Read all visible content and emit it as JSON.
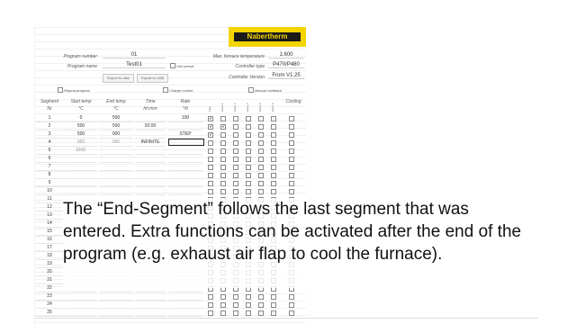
{
  "program": {
    "number_label": "Program number",
    "number_value": "01",
    "name_label": "Program name",
    "name_value": "Test01",
    "use_preset_label": "Use preset",
    "export_disk_label": "Export to disk",
    "export_usb_label": "Export to USB",
    "repeat_label": "Repeat program",
    "charge_label": "Charge control",
    "manual_holdback_label": "Manual holdback"
  },
  "furnace": {
    "max_temp_label": "Max. furnace temperature",
    "max_temp_value": "1.600",
    "controller_type_label": "Controller type",
    "controller_type_value": "P470/P480",
    "controller_version_label": "Controller Version",
    "controller_version_value": "From V1.25"
  },
  "logo_text": "Nabertherm",
  "table": {
    "headers": {
      "segment": "Segment",
      "segment_unit": "Nr",
      "start_temp": "Start temp",
      "start_unit": "°C",
      "end_temp": "End temp",
      "end_unit": "°C",
      "time": "Time",
      "time_unit": "hh:mm",
      "rate": "Rate",
      "rate_unit": "°/h",
      "cooling": "Cooling"
    },
    "extra_headers": [
      "Flap",
      "Extra 2",
      "Extra 3",
      "Extra 4",
      "Extra 5",
      "Extra 6"
    ],
    "rows": [
      {
        "nr": "1",
        "start": "0",
        "end": "500",
        "time": "",
        "rate": "100"
      },
      {
        "nr": "2",
        "start": "500",
        "end": "500",
        "time": "02:00",
        "rate": ""
      },
      {
        "nr": "3",
        "start": "500",
        "end": "900",
        "time": "",
        "rate": "STEP"
      },
      {
        "nr": "4",
        "start": "900",
        "end": "900",
        "time": "INFINITE",
        "rate": ""
      },
      {
        "nr": "5",
        "start": "END",
        "end": "",
        "time": "",
        "rate": ""
      },
      {
        "nr": "6",
        "start": "",
        "end": "",
        "time": "",
        "rate": ""
      },
      {
        "nr": "7",
        "start": "",
        "end": "",
        "time": "",
        "rate": ""
      },
      {
        "nr": "8",
        "start": "",
        "end": "",
        "time": "",
        "rate": ""
      },
      {
        "nr": "9",
        "start": "",
        "end": "",
        "time": "",
        "rate": ""
      },
      {
        "nr": "10",
        "start": "",
        "end": "",
        "time": "",
        "rate": ""
      },
      {
        "nr": "11",
        "start": "",
        "end": "",
        "time": "",
        "rate": ""
      },
      {
        "nr": "12",
        "start": "",
        "end": "",
        "time": "",
        "rate": ""
      },
      {
        "nr": "13",
        "start": "",
        "end": "",
        "time": "",
        "rate": ""
      },
      {
        "nr": "14",
        "start": "",
        "end": "",
        "time": "",
        "rate": ""
      },
      {
        "nr": "15",
        "start": "",
        "end": "",
        "time": "",
        "rate": ""
      },
      {
        "nr": "16",
        "start": "",
        "end": "",
        "time": "",
        "rate": ""
      },
      {
        "nr": "17",
        "start": "",
        "end": "",
        "time": "",
        "rate": ""
      },
      {
        "nr": "18",
        "start": "",
        "end": "",
        "time": "",
        "rate": ""
      },
      {
        "nr": "19",
        "start": "",
        "end": "",
        "time": "",
        "rate": ""
      },
      {
        "nr": "20",
        "start": "",
        "end": "",
        "time": "",
        "rate": ""
      },
      {
        "nr": "21",
        "start": "",
        "end": "",
        "time": "",
        "rate": ""
      },
      {
        "nr": "22",
        "start": "",
        "end": "",
        "time": "",
        "rate": ""
      },
      {
        "nr": "23",
        "start": "",
        "end": "",
        "time": "",
        "rate": ""
      },
      {
        "nr": "24",
        "start": "",
        "end": "",
        "time": "",
        "rate": ""
      },
      {
        "nr": "25",
        "start": "",
        "end": "",
        "time": "",
        "rate": ""
      }
    ]
  },
  "caption": "The “End-Segment” follows the last segment that was entered. Extra functions can be activated after the end of the program (e.g. exhaust air flap to cool the furnace).",
  "colors": {
    "logo_yellow": "#f2d500",
    "logo_black": "#1a1a1a"
  }
}
